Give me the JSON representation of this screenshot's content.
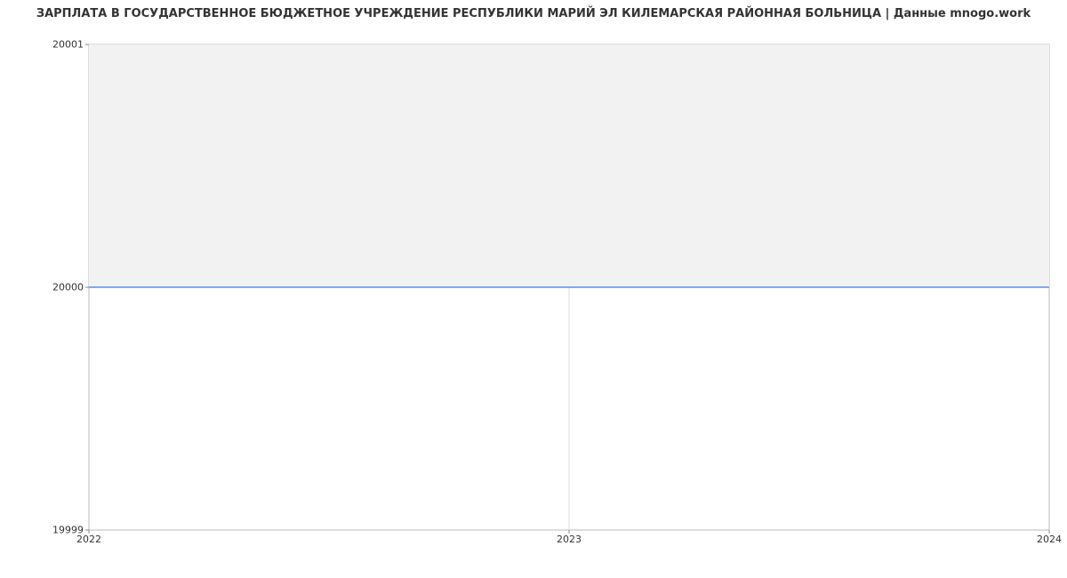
{
  "chart_data": {
    "type": "area",
    "title": "ЗАРПЛАТА В ГОСУДАРСТВЕННОЕ БЮДЖЕТНОЕ УЧРЕЖДЕНИЕ РЕСПУБЛИКИ МАРИЙ ЭЛ КИЛЕМАРСКАЯ РАЙОННАЯ БОЛЬНИЦА | Данные mnogo.work",
    "xlabel": "",
    "ylabel": "",
    "x": [
      2022,
      2023,
      2024
    ],
    "y": [
      20000,
      20000,
      20000
    ],
    "x_ticks": [
      "2022",
      "2023",
      "2024"
    ],
    "y_ticks": [
      "19999",
      "20000",
      "20001"
    ],
    "xlim": [
      2022,
      2024
    ],
    "ylim": [
      19999,
      20001
    ],
    "line_color": "#5b8def",
    "fill_color": "#f2f2f2"
  }
}
